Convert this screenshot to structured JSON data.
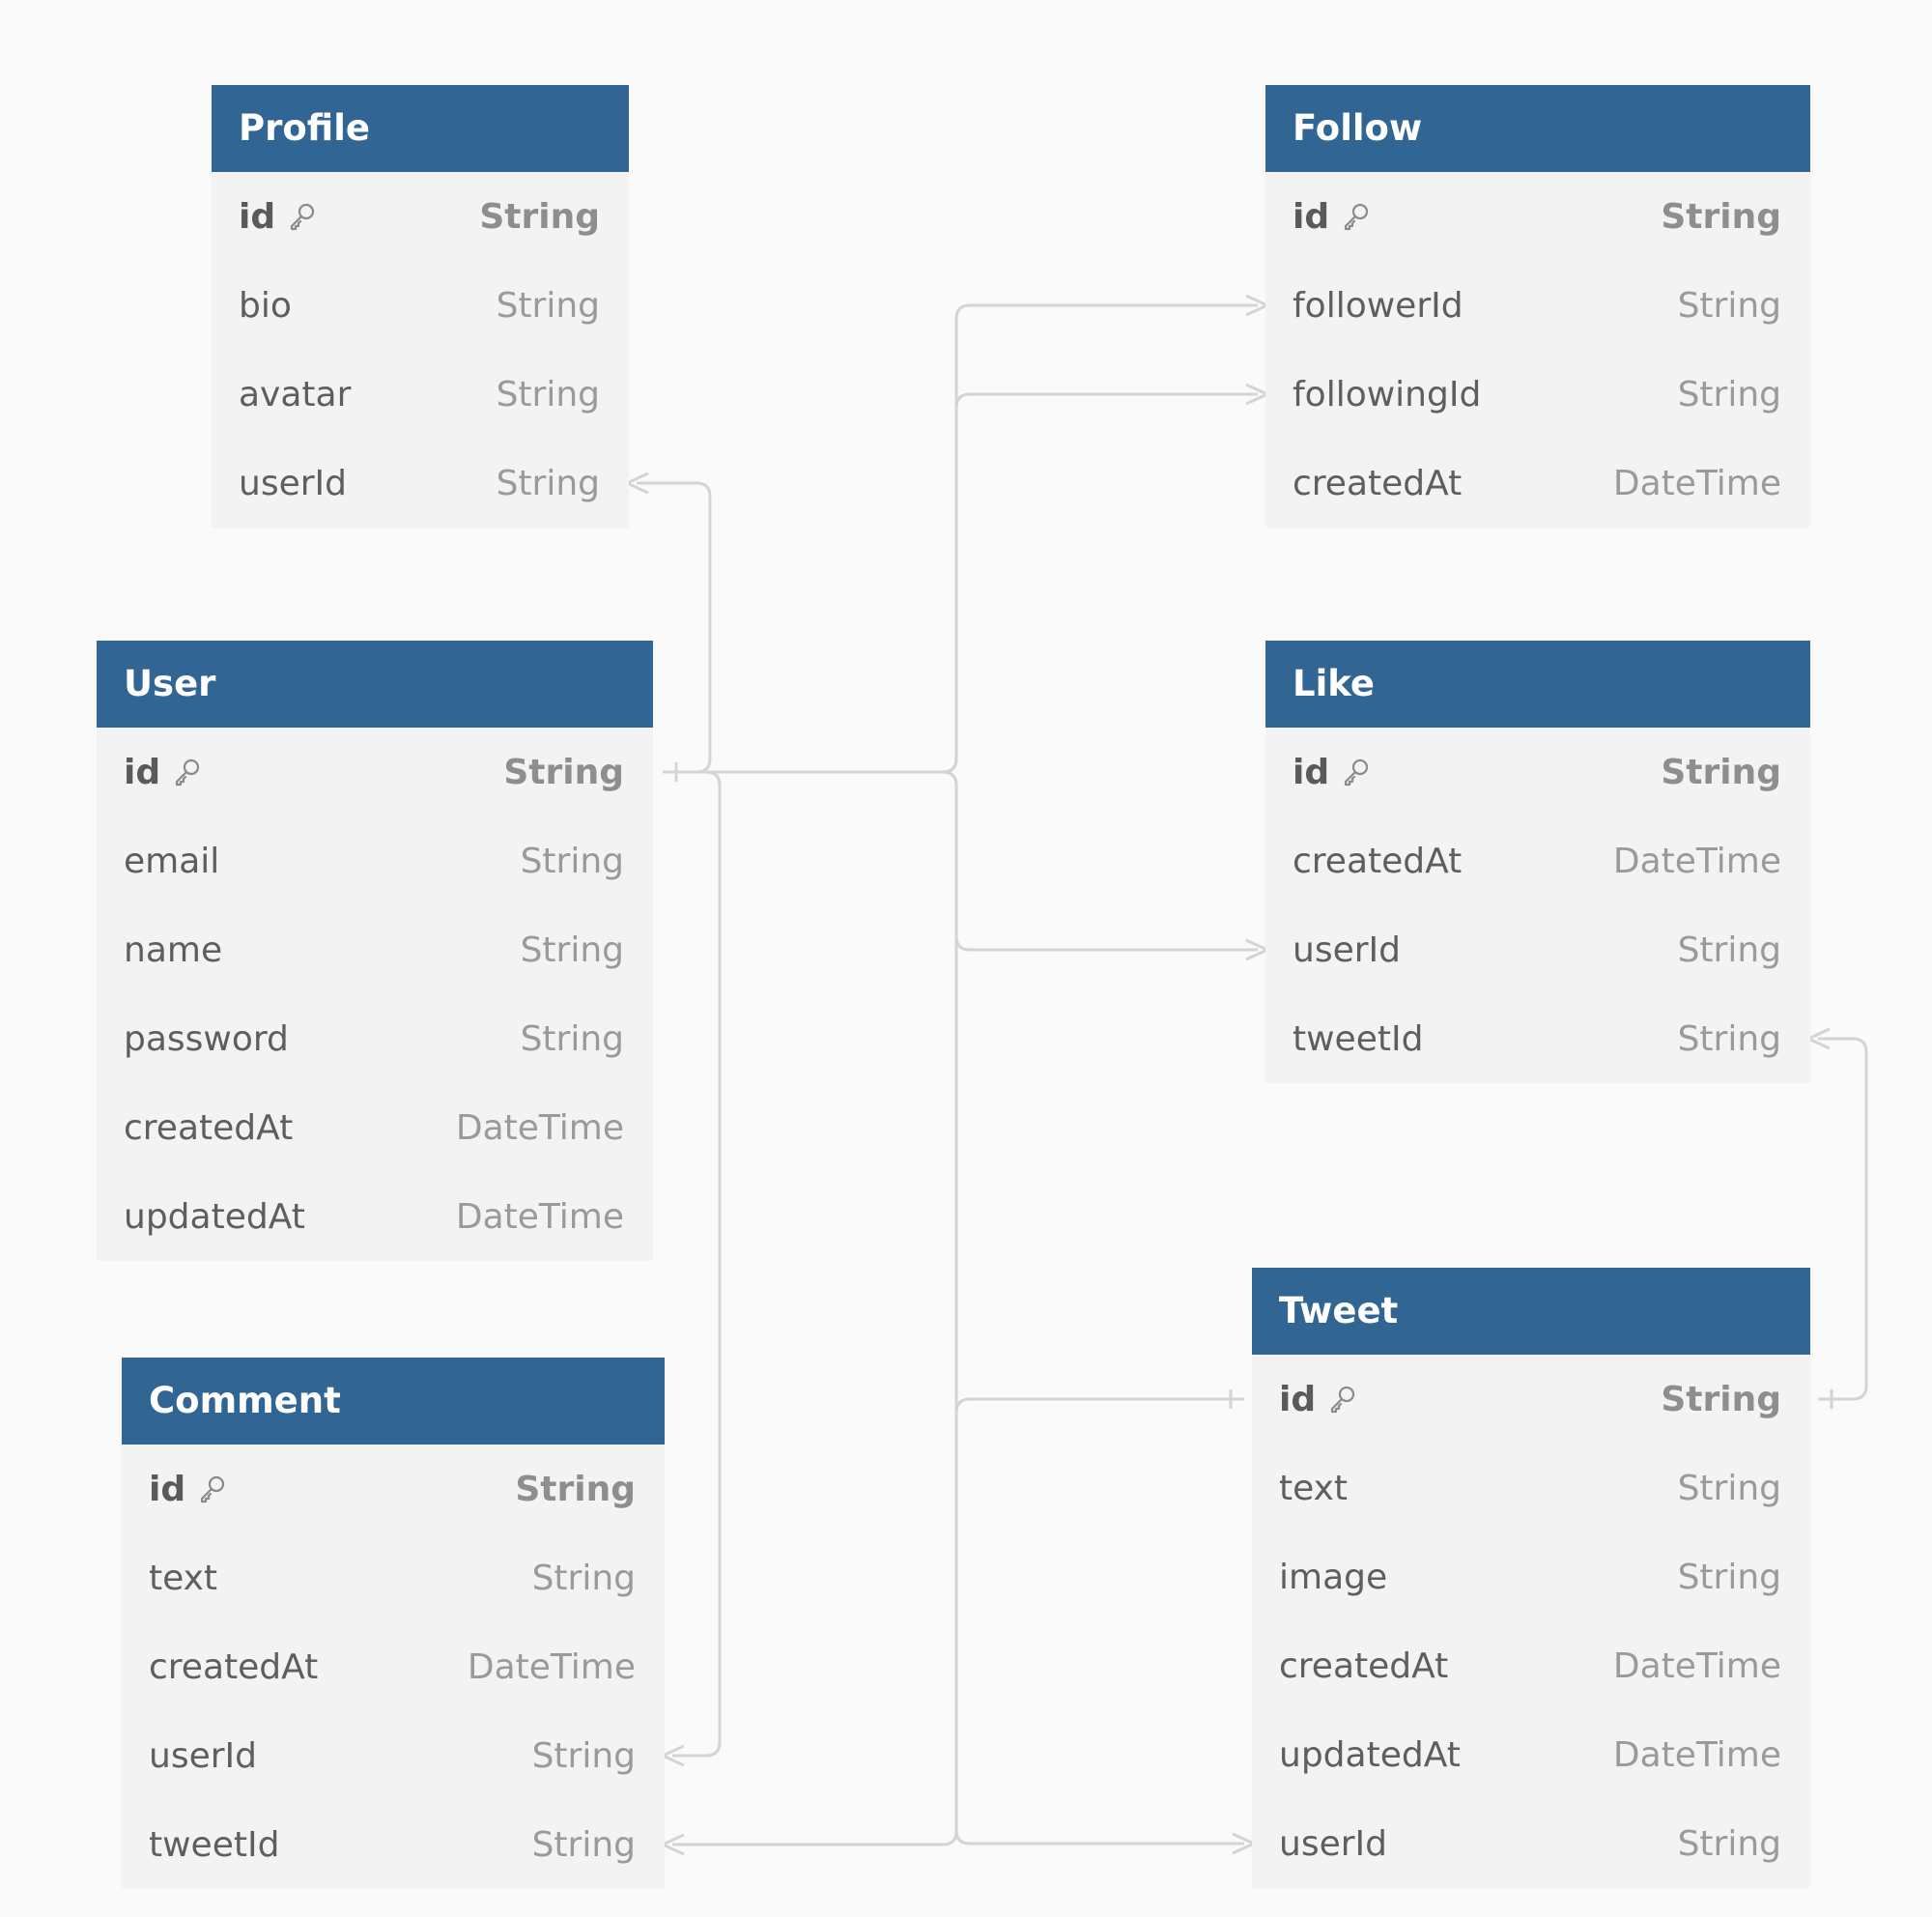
{
  "colors": {
    "header_bg": "#316594",
    "header_text": "#ffffff",
    "row_bg": "#f3f3f3",
    "canvas_bg": "#fafafa",
    "edge": "#d4d4d4"
  },
  "tables": [
    {
      "id": "profile",
      "name": "Profile",
      "fields": [
        {
          "name": "id",
          "type": "String",
          "pk": true
        },
        {
          "name": "bio",
          "type": "String"
        },
        {
          "name": "avatar",
          "type": "String"
        },
        {
          "name": "userId",
          "type": "String"
        }
      ]
    },
    {
      "id": "follow",
      "name": "Follow",
      "fields": [
        {
          "name": "id",
          "type": "String",
          "pk": true
        },
        {
          "name": "followerId",
          "type": "String"
        },
        {
          "name": "followingId",
          "type": "String"
        },
        {
          "name": "createdAt",
          "type": "DateTime"
        }
      ]
    },
    {
      "id": "user",
      "name": "User",
      "fields": [
        {
          "name": "id",
          "type": "String",
          "pk": true
        },
        {
          "name": "email",
          "type": "String"
        },
        {
          "name": "name",
          "type": "String"
        },
        {
          "name": "password",
          "type": "String"
        },
        {
          "name": "createdAt",
          "type": "DateTime"
        },
        {
          "name": "updatedAt",
          "type": "DateTime"
        }
      ]
    },
    {
      "id": "like",
      "name": "Like",
      "fields": [
        {
          "name": "id",
          "type": "String",
          "pk": true
        },
        {
          "name": "createdAt",
          "type": "DateTime"
        },
        {
          "name": "userId",
          "type": "String"
        },
        {
          "name": "tweetId",
          "type": "String"
        }
      ]
    },
    {
      "id": "comment",
      "name": "Comment",
      "fields": [
        {
          "name": "id",
          "type": "String",
          "pk": true
        },
        {
          "name": "text",
          "type": "String"
        },
        {
          "name": "createdAt",
          "type": "DateTime"
        },
        {
          "name": "userId",
          "type": "String"
        },
        {
          "name": "tweetId",
          "type": "String"
        }
      ]
    },
    {
      "id": "tweet",
      "name": "Tweet",
      "fields": [
        {
          "name": "id",
          "type": "String",
          "pk": true
        },
        {
          "name": "text",
          "type": "String"
        },
        {
          "name": "image",
          "type": "String"
        },
        {
          "name": "createdAt",
          "type": "DateTime"
        },
        {
          "name": "updatedAt",
          "type": "DateTime"
        },
        {
          "name": "userId",
          "type": "String"
        }
      ]
    }
  ],
  "relations": [
    {
      "from": "profile.userId",
      "to": "user.id"
    },
    {
      "from": "follow.followerId",
      "to": "user.id"
    },
    {
      "from": "follow.followingId",
      "to": "user.id"
    },
    {
      "from": "like.userId",
      "to": "user.id"
    },
    {
      "from": "like.tweetId",
      "to": "tweet.id"
    },
    {
      "from": "comment.userId",
      "to": "user.id"
    },
    {
      "from": "comment.tweetId",
      "to": "tweet.id"
    },
    {
      "from": "tweet.userId",
      "to": "user.id"
    }
  ]
}
